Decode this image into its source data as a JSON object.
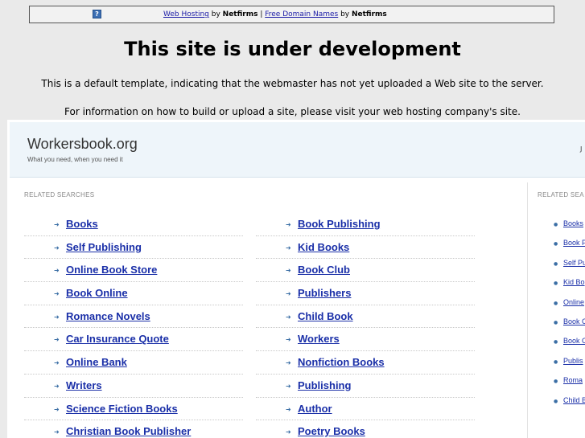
{
  "top_bar": {
    "help_icon": "question-mark-icon",
    "link1": "Web Hosting",
    "by1": " by ",
    "brand1": "Netfirms",
    "sep": " | ",
    "link2": "Free Domain Names",
    "by2": " by ",
    "brand2": "Netfirms"
  },
  "headline": "This site is under development",
  "notice_line1": "This is a default template, indicating that the webmaster has not yet uploaded a Web site to the server.",
  "notice_line2": "For information on how to build or upload a site, please visit your web hosting company's site.",
  "site": {
    "title": "Workersbook.org",
    "tagline": "What you need, when you need it",
    "right_text": "J"
  },
  "related_label": "RELATED SEARCHES",
  "side_label": "RELATED SEA",
  "left_column": [
    "Books",
    "Self Publishing",
    "Online Book Store",
    "Book Online",
    "Romance Novels",
    "Car Insurance Quote",
    "Online Bank",
    "Writers",
    "Science Fiction Books",
    "Christian Book Publisher"
  ],
  "right_column": [
    "Book Publishing",
    "Kid Books",
    "Book Club",
    "Publishers",
    "Child Book",
    "Workers",
    "Nonfiction Books",
    "Publishing",
    "Author",
    "Poetry Books"
  ],
  "side_links": [
    "Books",
    "Book P",
    "Self Pu",
    "Kid Bo",
    "Online",
    "Book C",
    "Book C",
    "Publis",
    "Roma",
    "Child B"
  ]
}
